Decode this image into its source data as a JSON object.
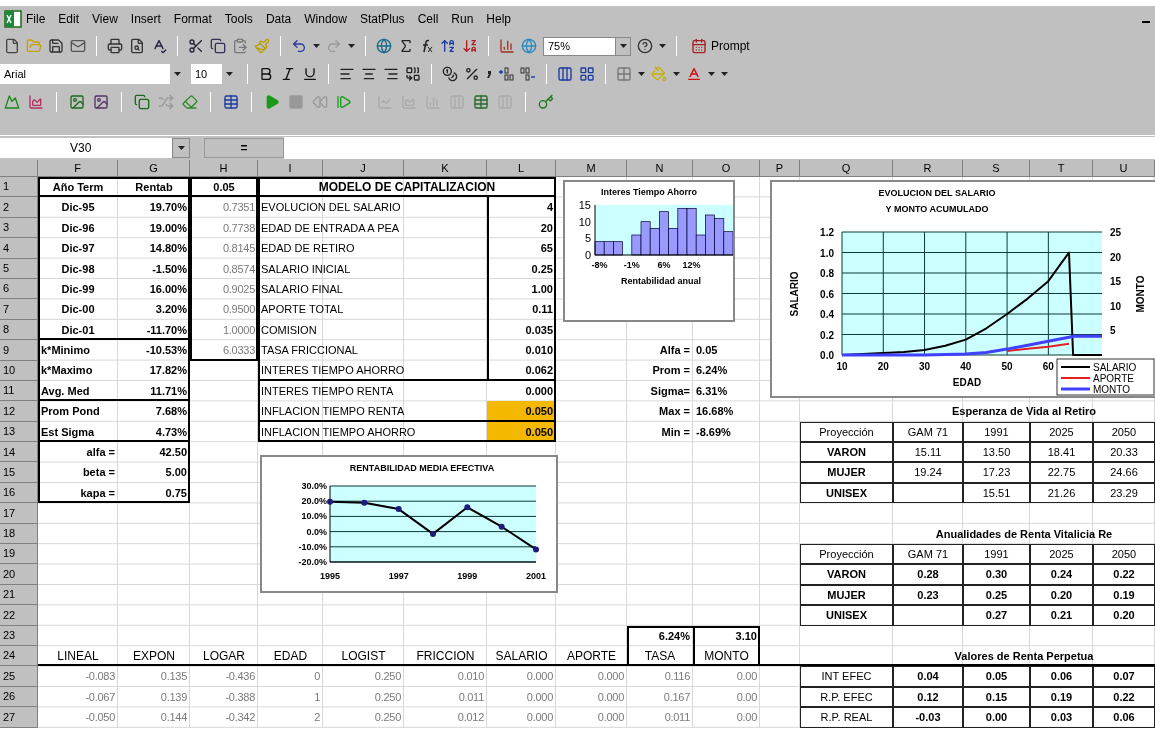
{
  "menu": [
    "File",
    "Edit",
    "View",
    "Insert",
    "Format",
    "Tools",
    "Data",
    "Window",
    "StatPlus",
    "Cell",
    "Run",
    "Help"
  ],
  "toolbar": {
    "zoom": "75%",
    "prompt_button": "Prompt",
    "font": "Arial",
    "font_size": "10"
  },
  "formula_bar": {
    "name_box": "V30",
    "equals_button": "="
  },
  "sheet": {
    "columns": [
      "F",
      "G",
      "H",
      "I",
      "J",
      "K",
      "L",
      "M",
      "N",
      "O",
      "P",
      "Q",
      "R",
      "S",
      "T",
      "U"
    ],
    "rows": [
      {
        "number": "1",
        "cells": [
          {
            "text": "Año Term",
            "kind": "head"
          },
          {
            "text": "Rentab",
            "kind": "head"
          },
          {
            "text": "0.05",
            "kind": "head"
          },
          {
            "text": "MODELO DE CAPITALIZACION",
            "kind": "title"
          }
        ]
      },
      {
        "number": "2",
        "cells": [
          {
            "text": "Dic-95",
            "kind": "center-bold"
          },
          {
            "text": "19.70%",
            "kind": "right-bold"
          },
          {
            "text": "0.7351",
            "kind": "small"
          },
          {
            "text": "EVOLUCION DEL SALARIO",
            "kind": "label"
          },
          null,
          null,
          {
            "text": "4",
            "kind": "right-bold"
          }
        ]
      },
      {
        "number": "3",
        "cells": [
          {
            "text": "Dic-96",
            "kind": "center-bold"
          },
          {
            "text": "19.00%",
            "kind": "right-bold"
          },
          {
            "text": "0.7738",
            "kind": "small"
          },
          {
            "text": "EDAD DE ENTRADA  A PEA",
            "kind": "label"
          },
          null,
          null,
          {
            "text": "20",
            "kind": "right-bold"
          }
        ]
      },
      {
        "number": "4",
        "cells": [
          {
            "text": "Dic-97",
            "kind": "center-bold"
          },
          {
            "text": "14.80%",
            "kind": "right-bold"
          },
          {
            "text": "0.8145",
            "kind": "small"
          },
          {
            "text": "EDAD DE RETIRO",
            "kind": "label"
          },
          null,
          null,
          {
            "text": "65",
            "kind": "right-bold"
          }
        ]
      },
      {
        "number": "5",
        "cells": [
          {
            "text": "Dic-98",
            "kind": "center-bold"
          },
          {
            "text": "-1.50%",
            "kind": "right-bold"
          },
          {
            "text": "0.8574",
            "kind": "small"
          },
          {
            "text": "SALARIO INICIAL",
            "kind": "label"
          },
          null,
          null,
          {
            "text": "0.25",
            "kind": "right-bold"
          }
        ]
      },
      {
        "number": "6",
        "cells": [
          {
            "text": "Dic-99",
            "kind": "center-bold"
          },
          {
            "text": "16.00%",
            "kind": "right-bold"
          },
          {
            "text": "0.9025",
            "kind": "small"
          },
          {
            "text": "SALARIO FINAL",
            "kind": "label"
          },
          null,
          null,
          {
            "text": "1.00",
            "kind": "right-bold"
          }
        ]
      },
      {
        "number": "7",
        "cells": [
          {
            "text": "Dic-00",
            "kind": "center-bold"
          },
          {
            "text": "3.20%",
            "kind": "right-bold"
          },
          {
            "text": "0.9500",
            "kind": "small"
          },
          {
            "text": "APORTE TOTAL",
            "kind": "label"
          },
          null,
          null,
          {
            "text": "0.11",
            "kind": "right-bold"
          }
        ]
      },
      {
        "number": "8",
        "cells": [
          {
            "text": "Dic-01",
            "kind": "center-bold"
          },
          {
            "text": "-11.70%",
            "kind": "right-bold"
          },
          {
            "text": "1.0000",
            "kind": "small"
          },
          {
            "text": "COMISION",
            "kind": "label"
          },
          null,
          null,
          {
            "text": "0.035",
            "kind": "right-bold"
          }
        ]
      },
      {
        "number": "9",
        "cells": [
          {
            "text": "k*Minimo",
            "kind": "left-bold"
          },
          {
            "text": "-10.53%",
            "kind": "right-bold"
          },
          {
            "text": "6.0333",
            "kind": "small"
          },
          {
            "text": "TASA FRICCIONAL",
            "kind": "label"
          },
          null,
          null,
          {
            "text": "0.010",
            "kind": "right-bold"
          },
          null,
          {
            "text": "Alfa =",
            "kind": "right-bold"
          },
          {
            "text": "0.05",
            "kind": "left-bold"
          }
        ]
      },
      {
        "number": "10",
        "cells": [
          {
            "text": "k*Maximo",
            "kind": "left-bold"
          },
          {
            "text": "17.82%",
            "kind": "right-bold"
          },
          null,
          {
            "text": "INTERES TIEMPO AHORRO",
            "kind": "label"
          },
          null,
          null,
          {
            "text": "0.062",
            "kind": "right-bold"
          },
          null,
          {
            "text": "Prom =",
            "kind": "right-bold"
          },
          {
            "text": "6.24%",
            "kind": "left-bold"
          }
        ]
      },
      {
        "number": "11",
        "cells": [
          {
            "text": "Avg. Med",
            "kind": "left-bold"
          },
          {
            "text": "11.71%",
            "kind": "right-bold"
          },
          null,
          {
            "text": "INTERES TIEMPO RENTA",
            "kind": "label"
          },
          null,
          null,
          {
            "text": "0.000",
            "kind": "right-bold"
          },
          null,
          {
            "text": "Sigma=",
            "kind": "right-bold"
          },
          {
            "text": "6.31%",
            "kind": "left-bold"
          }
        ]
      },
      {
        "number": "12",
        "cells": [
          {
            "text": "Prom Pond",
            "kind": "left-bold"
          },
          {
            "text": "7.68%",
            "kind": "right-bold"
          },
          null,
          {
            "text": "INFLACION TIEMPO RENTA",
            "kind": "label"
          },
          null,
          null,
          {
            "text": "0.050",
            "kind": "highlight"
          },
          null,
          {
            "text": "Max =",
            "kind": "right-bold"
          },
          {
            "text": "16.68%",
            "kind": "left-bold"
          },
          null,
          null,
          {
            "text": "Esperanza de Vida al Retiro",
            "kind": "caption"
          }
        ]
      },
      {
        "number": "13",
        "cells": [
          {
            "text": "Est Sigma",
            "kind": "left-bold"
          },
          {
            "text": "4.73%",
            "kind": "right-bold"
          },
          null,
          {
            "text": "INFLACION TIEMPO AHORRO",
            "kind": "label"
          },
          null,
          null,
          {
            "text": "0.050",
            "kind": "highlight"
          },
          null,
          {
            "text": "Min =",
            "kind": "right-bold"
          },
          {
            "text": "-8.69%",
            "kind": "left-bold"
          },
          null,
          {
            "text": "Proyección",
            "kind": "table"
          },
          {
            "text": "GAM 71",
            "kind": "table"
          },
          {
            "text": "1991",
            "kind": "table"
          },
          {
            "text": "2025",
            "kind": "table"
          },
          {
            "text": "2050",
            "kind": "table"
          }
        ]
      },
      {
        "number": "14",
        "cells": [
          {
            "text": "alfa =",
            "kind": "right-bold"
          },
          {
            "text": "42.50",
            "kind": "right-bold"
          },
          null,
          null,
          null,
          null,
          null,
          null,
          null,
          null,
          null,
          {
            "text": "VARON",
            "kind": "table-bold"
          },
          {
            "text": "15.11",
            "kind": "table"
          },
          {
            "text": "13.50",
            "kind": "table"
          },
          {
            "text": "18.41",
            "kind": "table"
          },
          {
            "text": "20.33",
            "kind": "table"
          }
        ]
      },
      {
        "number": "15",
        "cells": [
          {
            "text": "beta =",
            "kind": "right-bold"
          },
          {
            "text": "5.00",
            "kind": "right-bold"
          },
          null,
          null,
          null,
          null,
          null,
          null,
          null,
          null,
          null,
          {
            "text": "MUJER",
            "kind": "table-bold"
          },
          {
            "text": "19.24",
            "kind": "table"
          },
          {
            "text": "17.23",
            "kind": "table"
          },
          {
            "text": "22.75",
            "kind": "table"
          },
          {
            "text": "24.66",
            "kind": "table"
          }
        ]
      },
      {
        "number": "16",
        "cells": [
          {
            "text": "kapa =",
            "kind": "right-bold"
          },
          {
            "text": "0.75",
            "kind": "right-bold"
          },
          null,
          null,
          null,
          null,
          null,
          null,
          null,
          null,
          null,
          {
            "text": "UNISEX",
            "kind": "table-bold"
          },
          {
            "kind": "table"
          },
          {
            "text": "15.51",
            "kind": "table"
          },
          {
            "text": "21.26",
            "kind": "table"
          },
          {
            "text": "23.29",
            "kind": "table"
          }
        ]
      },
      {
        "number": "17",
        "cells": []
      },
      {
        "number": "18",
        "cells": [
          null,
          null,
          null,
          null,
          null,
          null,
          null,
          null,
          null,
          null,
          null,
          null,
          {
            "text": "Anualidades de Renta Vitalicia Re",
            "kind": "caption"
          }
        ]
      },
      {
        "number": "19",
        "cells": [
          null,
          null,
          null,
          null,
          null,
          null,
          null,
          null,
          null,
          null,
          null,
          {
            "text": "Proyección",
            "kind": "table"
          },
          {
            "text": "GAM 71",
            "kind": "table"
          },
          {
            "text": "1991",
            "kind": "table"
          },
          {
            "text": "2025",
            "kind": "table"
          },
          {
            "text": "2050",
            "kind": "table"
          }
        ]
      },
      {
        "number": "20",
        "cells": [
          null,
          null,
          null,
          null,
          null,
          null,
          null,
          null,
          null,
          null,
          null,
          {
            "text": "VARON",
            "kind": "table-bold"
          },
          {
            "text": "0.28",
            "kind": "table-bold"
          },
          {
            "text": "0.30",
            "kind": "table-bold"
          },
          {
            "text": "0.24",
            "kind": "table-bold"
          },
          {
            "text": "0.22",
            "kind": "table-bold"
          }
        ]
      },
      {
        "number": "21",
        "cells": [
          null,
          null,
          null,
          null,
          null,
          null,
          null,
          null,
          null,
          null,
          null,
          {
            "text": "MUJER",
            "kind": "table-bold"
          },
          {
            "text": "0.23",
            "kind": "table-bold"
          },
          {
            "text": "0.25",
            "kind": "table-bold"
          },
          {
            "text": "0.20",
            "kind": "table-bold"
          },
          {
            "text": "0.19",
            "kind": "table-bold"
          }
        ]
      },
      {
        "number": "22",
        "cells": [
          null,
          null,
          null,
          null,
          null,
          null,
          null,
          null,
          null,
          null,
          null,
          {
            "text": "UNISEX",
            "kind": "table-bold"
          },
          {
            "kind": "table"
          },
          {
            "text": "0.27",
            "kind": "table-bold"
          },
          {
            "text": "0.21",
            "kind": "table-bold"
          },
          {
            "text": "0.20",
            "kind": "table-bold"
          }
        ]
      },
      {
        "number": "23",
        "cells": [
          null,
          null,
          null,
          null,
          null,
          null,
          null,
          null,
          {
            "text": "6.24%",
            "kind": "right-bold"
          },
          {
            "text": "3.10",
            "kind": "right-bold"
          }
        ]
      },
      {
        "number": "24",
        "cells": [
          {
            "text": "LINEAL",
            "kind": "colhead"
          },
          {
            "text": "EXPON",
            "kind": "colhead"
          },
          {
            "text": "LOGAR",
            "kind": "colhead"
          },
          {
            "text": "EDAD",
            "kind": "colhead"
          },
          {
            "text": "LOGIST",
            "kind": "colhead"
          },
          {
            "text": "FRICCION",
            "kind": "colhead"
          },
          {
            "text": "SALARIO",
            "kind": "colhead"
          },
          {
            "text": "APORTE",
            "kind": "colhead"
          },
          {
            "text": "TASA",
            "kind": "colhead"
          },
          {
            "text": "MONTO",
            "kind": "colhead"
          },
          null,
          null,
          {
            "text": "Valores de Renta Perpetua",
            "kind": "caption"
          }
        ]
      },
      {
        "number": "25",
        "cells": [
          {
            "text": "-0.083",
            "kind": "small"
          },
          {
            "text": "0.135",
            "kind": "small"
          },
          {
            "text": "-0.436",
            "kind": "small"
          },
          {
            "text": "0",
            "kind": "small"
          },
          {
            "text": "0.250",
            "kind": "small"
          },
          {
            "text": "0.010",
            "kind": "small"
          },
          {
            "text": "0.000",
            "kind": "small"
          },
          {
            "text": "0.000",
            "kind": "small"
          },
          {
            "text": "0.116",
            "kind": "small"
          },
          {
            "text": "0.00",
            "kind": "small"
          },
          null,
          {
            "text": "INT EFEC",
            "kind": "table"
          },
          {
            "text": "0.04",
            "kind": "table-bold"
          },
          {
            "text": "0.05",
            "kind": "table-bold"
          },
          {
            "text": "0.06",
            "kind": "table-bold"
          },
          {
            "text": "0.07",
            "kind": "table-bold"
          }
        ]
      },
      {
        "number": "26",
        "cells": [
          {
            "text": "-0.067",
            "kind": "small"
          },
          {
            "text": "0.139",
            "kind": "small"
          },
          {
            "text": "-0.388",
            "kind": "small"
          },
          {
            "text": "1",
            "kind": "small"
          },
          {
            "text": "0.250",
            "kind": "small"
          },
          {
            "text": "0.011",
            "kind": "small"
          },
          {
            "text": "0.000",
            "kind": "small"
          },
          {
            "text": "0.000",
            "kind": "small"
          },
          {
            "text": "0.167",
            "kind": "small"
          },
          {
            "text": "0.00",
            "kind": "small"
          },
          null,
          {
            "text": "R.P. EFEC",
            "kind": "table"
          },
          {
            "text": "0.12",
            "kind": "table-bold"
          },
          {
            "text": "0.15",
            "kind": "table-bold"
          },
          {
            "text": "0.19",
            "kind": "table-bold"
          },
          {
            "text": "0.22",
            "kind": "table-bold"
          }
        ]
      },
      {
        "number": "27",
        "cells": [
          {
            "text": "-0.050",
            "kind": "small"
          },
          {
            "text": "0.144",
            "kind": "small"
          },
          {
            "text": "-0.342",
            "kind": "small"
          },
          {
            "text": "2",
            "kind": "small"
          },
          {
            "text": "0.250",
            "kind": "small"
          },
          {
            "text": "0.012",
            "kind": "small"
          },
          {
            "text": "0.000",
            "kind": "small"
          },
          {
            "text": "0.000",
            "kind": "small"
          },
          {
            "text": "0.011",
            "kind": "small"
          },
          {
            "text": "0.00",
            "kind": "small"
          },
          null,
          {
            "text": "R.P. REAL",
            "kind": "table"
          },
          {
            "text": "-0.03",
            "kind": "table-bold"
          },
          {
            "text": "0.00",
            "kind": "table-bold"
          },
          {
            "text": "0.03",
            "kind": "table-bold"
          },
          {
            "text": "0.06",
            "kind": "table-bold"
          }
        ]
      }
    ],
    "charts": [
      {
        "chart_data": {
          "type": "bar",
          "title": "Interes Tiempo Ahorro",
          "xlabel": "Rentabilidad anual",
          "x": [
            -8,
            -6,
            -4,
            -2,
            0,
            2,
            4,
            6,
            8,
            10,
            12,
            14,
            16,
            18,
            20
          ],
          "xlim": [
            -9,
            21
          ],
          "values": [
            4,
            4,
            4,
            0,
            6,
            10,
            8,
            13,
            8,
            14,
            14,
            6,
            12,
            11,
            7
          ],
          "color": "#9999ff",
          "xticks": [
            {
              "value": -8,
              "label": "-8%"
            },
            {
              "value": -1,
              "label": "-1%"
            },
            {
              "value": 6,
              "label": "6%"
            },
            {
              "value": 12,
              "label": "12%"
            }
          ],
          "ylim": [
            0,
            15
          ],
          "yticks": [
            {
              "value": 0,
              "label": "0"
            },
            {
              "value": 5,
              "label": "5"
            },
            {
              "value": 10,
              "label": "10"
            },
            {
              "value": 15,
              "label": "15"
            }
          ]
        }
      },
      {
        "chart_data": {
          "type": "line",
          "title": "EVOLUCION DEL SALARIO",
          "subtitle": "Y MONTO ACUMULADO",
          "xlabel": "EDAD",
          "ylabel": "SALARIO",
          "y2label": "MONTO",
          "grid": true,
          "legend": "lower right",
          "x": [
            10,
            20,
            25,
            30,
            35,
            40,
            45,
            50,
            55,
            60,
            65,
            66,
            73
          ],
          "xlim": [
            10,
            73
          ],
          "ylim": [
            0,
            1.2
          ],
          "y2lim": [
            0,
            25
          ],
          "xticks": [
            {
              "value": 10,
              "label": "10"
            },
            {
              "value": 20,
              "label": "20"
            },
            {
              "value": 30,
              "label": "30"
            },
            {
              "value": 40,
              "label": "40"
            },
            {
              "value": 50,
              "label": "50"
            },
            {
              "value": 60,
              "label": "60"
            }
          ],
          "yticks": [
            {
              "value": 0,
              "label": "0.0"
            },
            {
              "value": 0.2,
              "label": "0.2"
            },
            {
              "value": 0.4,
              "label": "0.4"
            },
            {
              "value": 0.6,
              "label": "0.6"
            },
            {
              "value": 0.8,
              "label": "0.8"
            },
            {
              "value": 1,
              "label": "1.0"
            },
            {
              "value": 1.2,
              "label": "1.2"
            }
          ],
          "y2ticks": [
            {
              "value": 5,
              "label": "5"
            },
            {
              "value": 10,
              "label": "10"
            },
            {
              "value": 15,
              "label": "15"
            },
            {
              "value": 20,
              "label": "20"
            },
            {
              "value": 25,
              "label": "25"
            }
          ],
          "series": [
            {
              "name": "SALARIO",
              "color": "#000000",
              "values": [
                0,
                0.02,
                0.03,
                0.05,
                0.09,
                0.15,
                0.26,
                0.4,
                0.55,
                0.72,
                1.0,
                0,
                0
              ]
            },
            {
              "name": "APORTE",
              "color": "#e02020",
              "values": [
                null,
                null,
                null,
                null,
                null,
                null,
                null,
                0.04,
                0.06,
                0.08,
                0.11,
                null,
                null
              ]
            },
            {
              "name": "MONTO",
              "color": "#4040ff",
              "axis": "y2",
              "values": [
                0,
                0,
                0,
                0,
                0.1,
                0.2,
                0.5,
                1.2,
                2,
                2.8,
                3.6,
                3.8,
                3.8
              ]
            }
          ]
        }
      },
      {
        "chart_data": {
          "type": "line",
          "title": "RENTABILIDAD  MEDIA EFECTIVA",
          "grid": true,
          "x": [
            1995,
            1996,
            1997,
            1998,
            1999,
            2000,
            2001
          ],
          "xlim": [
            1995,
            2001
          ],
          "series": [
            {
              "color": "#000000",
              "marker": "circle",
              "values": [
                19.7,
                19.0,
                14.8,
                -1.5,
                16.0,
                3.2,
                -11.7
              ]
            }
          ],
          "ylim": [
            -20,
            30
          ],
          "yticks": [
            {
              "value": 30,
              "label": "30.0%"
            },
            {
              "value": 20,
              "label": "20.0%"
            },
            {
              "value": 10,
              "label": "10.0%"
            },
            {
              "value": 0,
              "label": "0.0%"
            },
            {
              "value": -10,
              "label": "-10.0%"
            },
            {
              "value": -20,
              "label": "-20.0%"
            }
          ],
          "xticks": [
            1995,
            1997,
            1999,
            2001
          ]
        }
      }
    ]
  }
}
